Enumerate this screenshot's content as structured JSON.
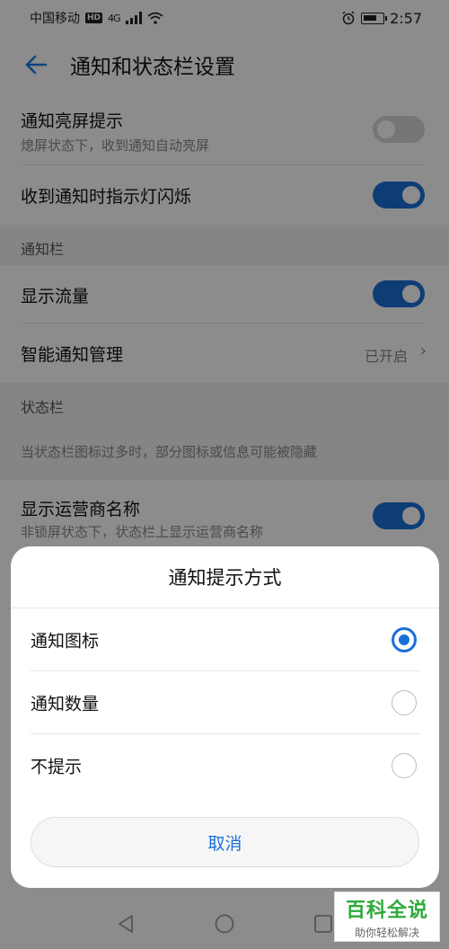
{
  "statusbar": {
    "carrier": "中国移动",
    "hd": "HD",
    "network": "4G",
    "time": "2:57"
  },
  "header": {
    "title": "通知和状态栏设置",
    "back_icon": "arrow-left-icon"
  },
  "settings": {
    "wake_screen": {
      "title": "通知亮屏提示",
      "subtitle": "熄屏状态下，收到通知自动亮屏",
      "enabled": false
    },
    "led_blink": {
      "title": "收到通知时指示灯闪烁",
      "enabled": true
    },
    "section_notification_bar": "通知栏",
    "show_traffic": {
      "title": "显示流量",
      "enabled": true
    },
    "smart_manage": {
      "title": "智能通知管理",
      "value": "已开启"
    },
    "section_status_bar": "状态栏",
    "status_hint": "当状态栏图标过多时，部分图标或信息可能被隐藏",
    "show_carrier": {
      "title": "显示运营商名称",
      "subtitle": "非锁屏状态下，状态栏上显示运营商名称",
      "enabled": true
    }
  },
  "dialog": {
    "title": "通知提示方式",
    "options": [
      {
        "label": "通知图标",
        "selected": true
      },
      {
        "label": "通知数量",
        "selected": false
      },
      {
        "label": "不提示",
        "selected": false
      }
    ],
    "cancel": "取消"
  },
  "watermark": {
    "main": "百科全说",
    "sub": "助你轻松解决"
  },
  "colors": {
    "accent": "#1a6fd8",
    "switch_off": "#d8d8d8",
    "watermark_green": "#2eaa3a"
  }
}
